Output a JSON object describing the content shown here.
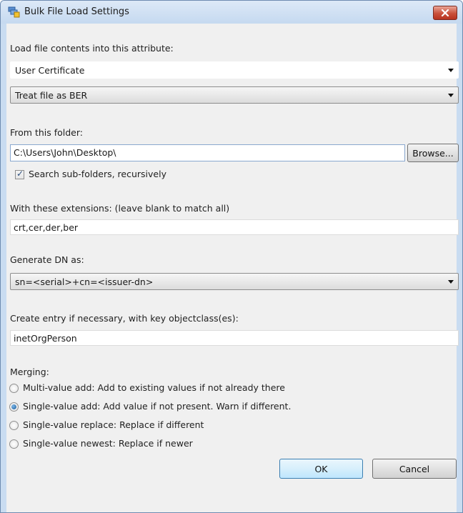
{
  "window": {
    "title": "Bulk File Load Settings",
    "icon": "app-icon",
    "close_icon": "close-icon"
  },
  "attribute": {
    "label": "Load file contents into this attribute:",
    "value": "User Certificate"
  },
  "treat_as": {
    "value": "Treat file as BER"
  },
  "folder": {
    "label": "From this folder:",
    "value": "C:\\Users\\John\\Desktop\\",
    "browse_label": "Browse..."
  },
  "recursive": {
    "label": "Search sub-folders, recursively",
    "checked": true
  },
  "extensions": {
    "label": "With these extensions:   (leave blank to match all)",
    "value": "crt,cer,der,ber"
  },
  "dn": {
    "label": "Generate DN as:",
    "value": "sn=<serial>+cn=<issuer-dn>"
  },
  "objectclass": {
    "label": "Create entry if necessary, with key objectclass(es):",
    "value": "inetOrgPerson"
  },
  "merging": {
    "label": "Merging:",
    "options": [
      {
        "label": "Multi-value add:  Add to existing values if not already there",
        "selected": false
      },
      {
        "label": "Single-value add:  Add value if not present.  Warn if different.",
        "selected": true
      },
      {
        "label": "Single-value replace:  Replace if different",
        "selected": false
      },
      {
        "label": "Single-value newest:  Replace if newer",
        "selected": false
      }
    ]
  },
  "buttons": {
    "ok": "OK",
    "cancel": "Cancel"
  },
  "colors": {
    "window_frame": "#c9dcf1",
    "close_red": "#c9503a",
    "default_button": "#3c7fb1"
  }
}
